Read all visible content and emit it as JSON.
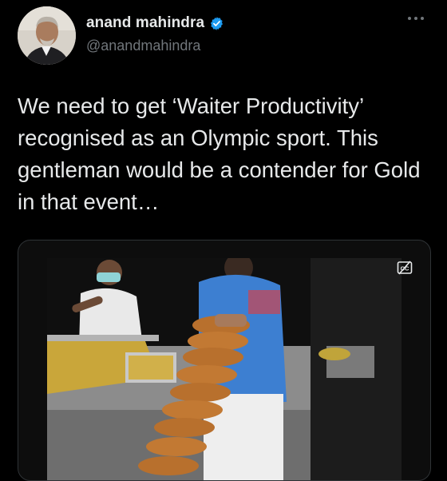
{
  "tweet": {
    "author": {
      "display_name": "anand mahindra",
      "handle": "@anandmahindra",
      "verified": true,
      "avatar_icon": "profile-photo"
    },
    "text": "We need to get ‘Waiter Productivity’ recognised as an Olympic sport. This gentleman would be a contender for Gold in that event…",
    "more_icon": "more-options-icon",
    "media": {
      "type": "video",
      "subject": "waiter carrying a tall stack of dosa plates in a kitchen",
      "caption_icon": "closed-captions-icon"
    }
  },
  "colors": {
    "background": "#000000",
    "text_primary": "#e7e9ea",
    "text_secondary": "#71767b",
    "verified_blue": "#1d9bf0",
    "card_border": "#2f3336"
  }
}
